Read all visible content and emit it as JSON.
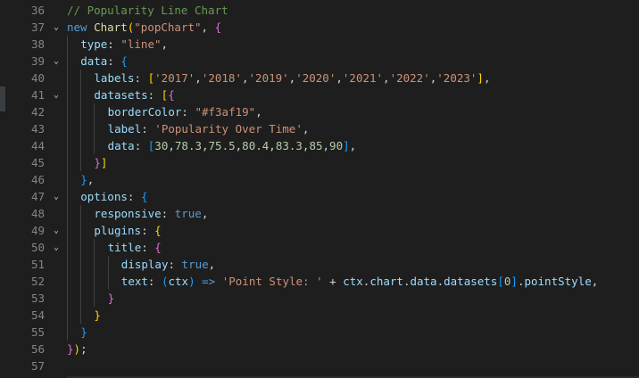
{
  "editor": {
    "lines": [
      {
        "num": "36",
        "fold": "",
        "indent": 0,
        "tokens": [
          [
            "c",
            "// Popularity Line Chart"
          ]
        ]
      },
      {
        "num": "37",
        "fold": "⌄",
        "indent": 0,
        "tokens": [
          [
            "k",
            "new"
          ],
          [
            "t",
            " "
          ],
          [
            "f",
            "Chart"
          ],
          [
            "b1",
            "("
          ],
          [
            "s",
            "\"popChart\""
          ],
          [
            "t",
            ", "
          ],
          [
            "b2",
            "{"
          ]
        ]
      },
      {
        "num": "38",
        "fold": "",
        "indent": 1,
        "tokens": [
          [
            "p",
            "type"
          ],
          [
            "t",
            ": "
          ],
          [
            "s",
            "\"line\""
          ],
          [
            "t",
            ","
          ]
        ]
      },
      {
        "num": "39",
        "fold": "⌄",
        "indent": 1,
        "tokens": [
          [
            "p",
            "data"
          ],
          [
            "t",
            ": "
          ],
          [
            "b3",
            "{"
          ]
        ]
      },
      {
        "num": "40",
        "fold": "",
        "indent": 2,
        "tokens": [
          [
            "p",
            "labels"
          ],
          [
            "t",
            ": "
          ],
          [
            "b1",
            "["
          ],
          [
            "s",
            "'2017'"
          ],
          [
            "t",
            ","
          ],
          [
            "s",
            "'2018'"
          ],
          [
            "t",
            ","
          ],
          [
            "s",
            "'2019'"
          ],
          [
            "t",
            ","
          ],
          [
            "s",
            "'2020'"
          ],
          [
            "t",
            ","
          ],
          [
            "s",
            "'2021'"
          ],
          [
            "t",
            ","
          ],
          [
            "s",
            "'2022'"
          ],
          [
            "t",
            ","
          ],
          [
            "s",
            "'2023'"
          ],
          [
            "b1",
            "]"
          ],
          [
            "t",
            ","
          ]
        ]
      },
      {
        "num": "41",
        "fold": "⌄",
        "indent": 2,
        "tokens": [
          [
            "p",
            "datasets"
          ],
          [
            "t",
            ": "
          ],
          [
            "b1",
            "["
          ],
          [
            "b2",
            "{"
          ]
        ]
      },
      {
        "num": "42",
        "fold": "",
        "indent": 3,
        "tokens": [
          [
            "p",
            "borderColor"
          ],
          [
            "t",
            ": "
          ],
          [
            "s",
            "\"#f3af19\""
          ],
          [
            "t",
            ","
          ]
        ]
      },
      {
        "num": "43",
        "fold": "",
        "indent": 3,
        "tokens": [
          [
            "p",
            "label"
          ],
          [
            "t",
            ": "
          ],
          [
            "s",
            "'Popularity Over Time'"
          ],
          [
            "t",
            ","
          ]
        ]
      },
      {
        "num": "44",
        "fold": "",
        "indent": 3,
        "tokens": [
          [
            "p",
            "data"
          ],
          [
            "t",
            ": "
          ],
          [
            "b3",
            "["
          ],
          [
            "n",
            "30"
          ],
          [
            "t",
            ","
          ],
          [
            "n",
            "78.3"
          ],
          [
            "t",
            ","
          ],
          [
            "n",
            "75.5"
          ],
          [
            "t",
            ","
          ],
          [
            "n",
            "80.4"
          ],
          [
            "t",
            ","
          ],
          [
            "n",
            "83.3"
          ],
          [
            "t",
            ","
          ],
          [
            "n",
            "85"
          ],
          [
            "t",
            ","
          ],
          [
            "n",
            "90"
          ],
          [
            "b3",
            "]"
          ],
          [
            "t",
            ","
          ]
        ]
      },
      {
        "num": "45",
        "fold": "",
        "indent": 2,
        "tokens": [
          [
            "b2",
            "}"
          ],
          [
            "b1",
            "]"
          ]
        ]
      },
      {
        "num": "46",
        "fold": "",
        "indent": 1,
        "tokens": [
          [
            "b3",
            "}"
          ],
          [
            "t",
            ","
          ]
        ]
      },
      {
        "num": "47",
        "fold": "⌄",
        "indent": 1,
        "tokens": [
          [
            "p",
            "options"
          ],
          [
            "t",
            ": "
          ],
          [
            "b3",
            "{"
          ]
        ]
      },
      {
        "num": "48",
        "fold": "",
        "indent": 2,
        "tokens": [
          [
            "p",
            "responsive"
          ],
          [
            "t",
            ": "
          ],
          [
            "k",
            "true"
          ],
          [
            "t",
            ","
          ]
        ]
      },
      {
        "num": "49",
        "fold": "⌄",
        "indent": 2,
        "tokens": [
          [
            "p",
            "plugins"
          ],
          [
            "t",
            ": "
          ],
          [
            "b1",
            "{"
          ]
        ]
      },
      {
        "num": "50",
        "fold": "⌄",
        "indent": 3,
        "tokens": [
          [
            "p",
            "title"
          ],
          [
            "t",
            ": "
          ],
          [
            "b2",
            "{"
          ]
        ]
      },
      {
        "num": "51",
        "fold": "",
        "indent": 4,
        "tokens": [
          [
            "p",
            "display"
          ],
          [
            "t",
            ": "
          ],
          [
            "k",
            "true"
          ],
          [
            "t",
            ","
          ]
        ]
      },
      {
        "num": "52",
        "fold": "",
        "indent": 4,
        "tokens": [
          [
            "p",
            "text"
          ],
          [
            "t",
            ": "
          ],
          [
            "b3",
            "("
          ],
          [
            "p",
            "ctx"
          ],
          [
            "b3",
            ")"
          ],
          [
            "t",
            " "
          ],
          [
            "k",
            "=>"
          ],
          [
            "t",
            " "
          ],
          [
            "s",
            "'Point Style: '"
          ],
          [
            "t",
            " + "
          ],
          [
            "p",
            "ctx"
          ],
          [
            "t",
            "."
          ],
          [
            "p",
            "chart"
          ],
          [
            "t",
            "."
          ],
          [
            "p",
            "data"
          ],
          [
            "t",
            "."
          ],
          [
            "p",
            "datasets"
          ],
          [
            "b3",
            "["
          ],
          [
            "n",
            "0"
          ],
          [
            "b3",
            "]"
          ],
          [
            "t",
            "."
          ],
          [
            "p",
            "pointStyle"
          ],
          [
            "t",
            ","
          ]
        ]
      },
      {
        "num": "53",
        "fold": "",
        "indent": 3,
        "tokens": [
          [
            "b2",
            "}"
          ]
        ]
      },
      {
        "num": "54",
        "fold": "",
        "indent": 2,
        "tokens": [
          [
            "b1",
            "}"
          ]
        ]
      },
      {
        "num": "55",
        "fold": "",
        "indent": 1,
        "tokens": [
          [
            "b3",
            "}"
          ]
        ]
      },
      {
        "num": "56",
        "fold": "",
        "indent": 0,
        "tokens": [
          [
            "b2",
            "}"
          ],
          [
            "b1",
            ")"
          ],
          [
            "t",
            ";"
          ]
        ]
      },
      {
        "num": "57",
        "fold": "",
        "indent": 0,
        "tokens": []
      }
    ]
  }
}
